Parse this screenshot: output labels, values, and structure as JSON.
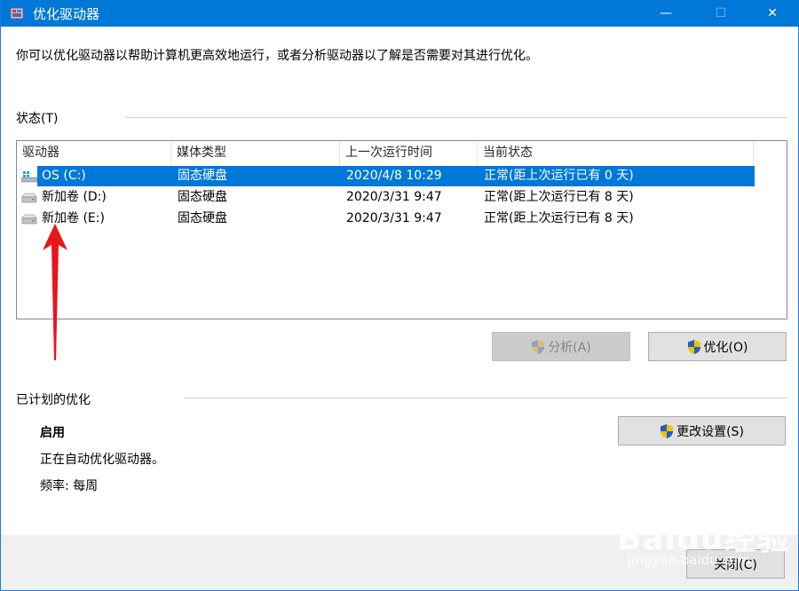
{
  "window": {
    "title": "优化驱动器",
    "controls": {
      "minimize": "—",
      "maximize": "☐",
      "close": "✕"
    }
  },
  "intro_text": "你可以优化驱动器以帮助计算机更高效地运行，或者分析驱动器以了解是否需要对其进行优化。",
  "status_section": {
    "label": "状态(T)",
    "columns": [
      "驱动器",
      "媒体类型",
      "上一次运行时间",
      "当前状态"
    ],
    "rows": [
      {
        "drive": "OS (C:)",
        "media": "固态硬盘",
        "last_run": "2020/4/8 10:29",
        "status": "正常(距上次运行已有 0 天)",
        "icon": "windows-drive-icon",
        "selected": true
      },
      {
        "drive": "新加卷 (D:)",
        "media": "固态硬盘",
        "last_run": "2020/3/31 9:47",
        "status": "正常(距上次运行已有 8 天)",
        "icon": "drive-icon",
        "selected": false
      },
      {
        "drive": "新加卷 (E:)",
        "media": "固态硬盘",
        "last_run": "2020/3/31 9:47",
        "status": "正常(距上次运行已有 8 天)",
        "icon": "drive-icon",
        "selected": false
      }
    ],
    "analyze_button": "分析(A)",
    "optimize_button": "优化(O)"
  },
  "scheduled_section": {
    "label": "已计划的优化",
    "state": "启用",
    "description": "正在自动优化驱动器。",
    "frequency": "频率: 每周",
    "change_settings_button": "更改设置(S)"
  },
  "footer": {
    "close_button": "关闭(C)"
  },
  "watermark": {
    "brand": "Baidu经验",
    "url": "jingyan.baidu.com"
  },
  "colors": {
    "accent": "#0078d7",
    "annotation_arrow": "#e8151b"
  }
}
